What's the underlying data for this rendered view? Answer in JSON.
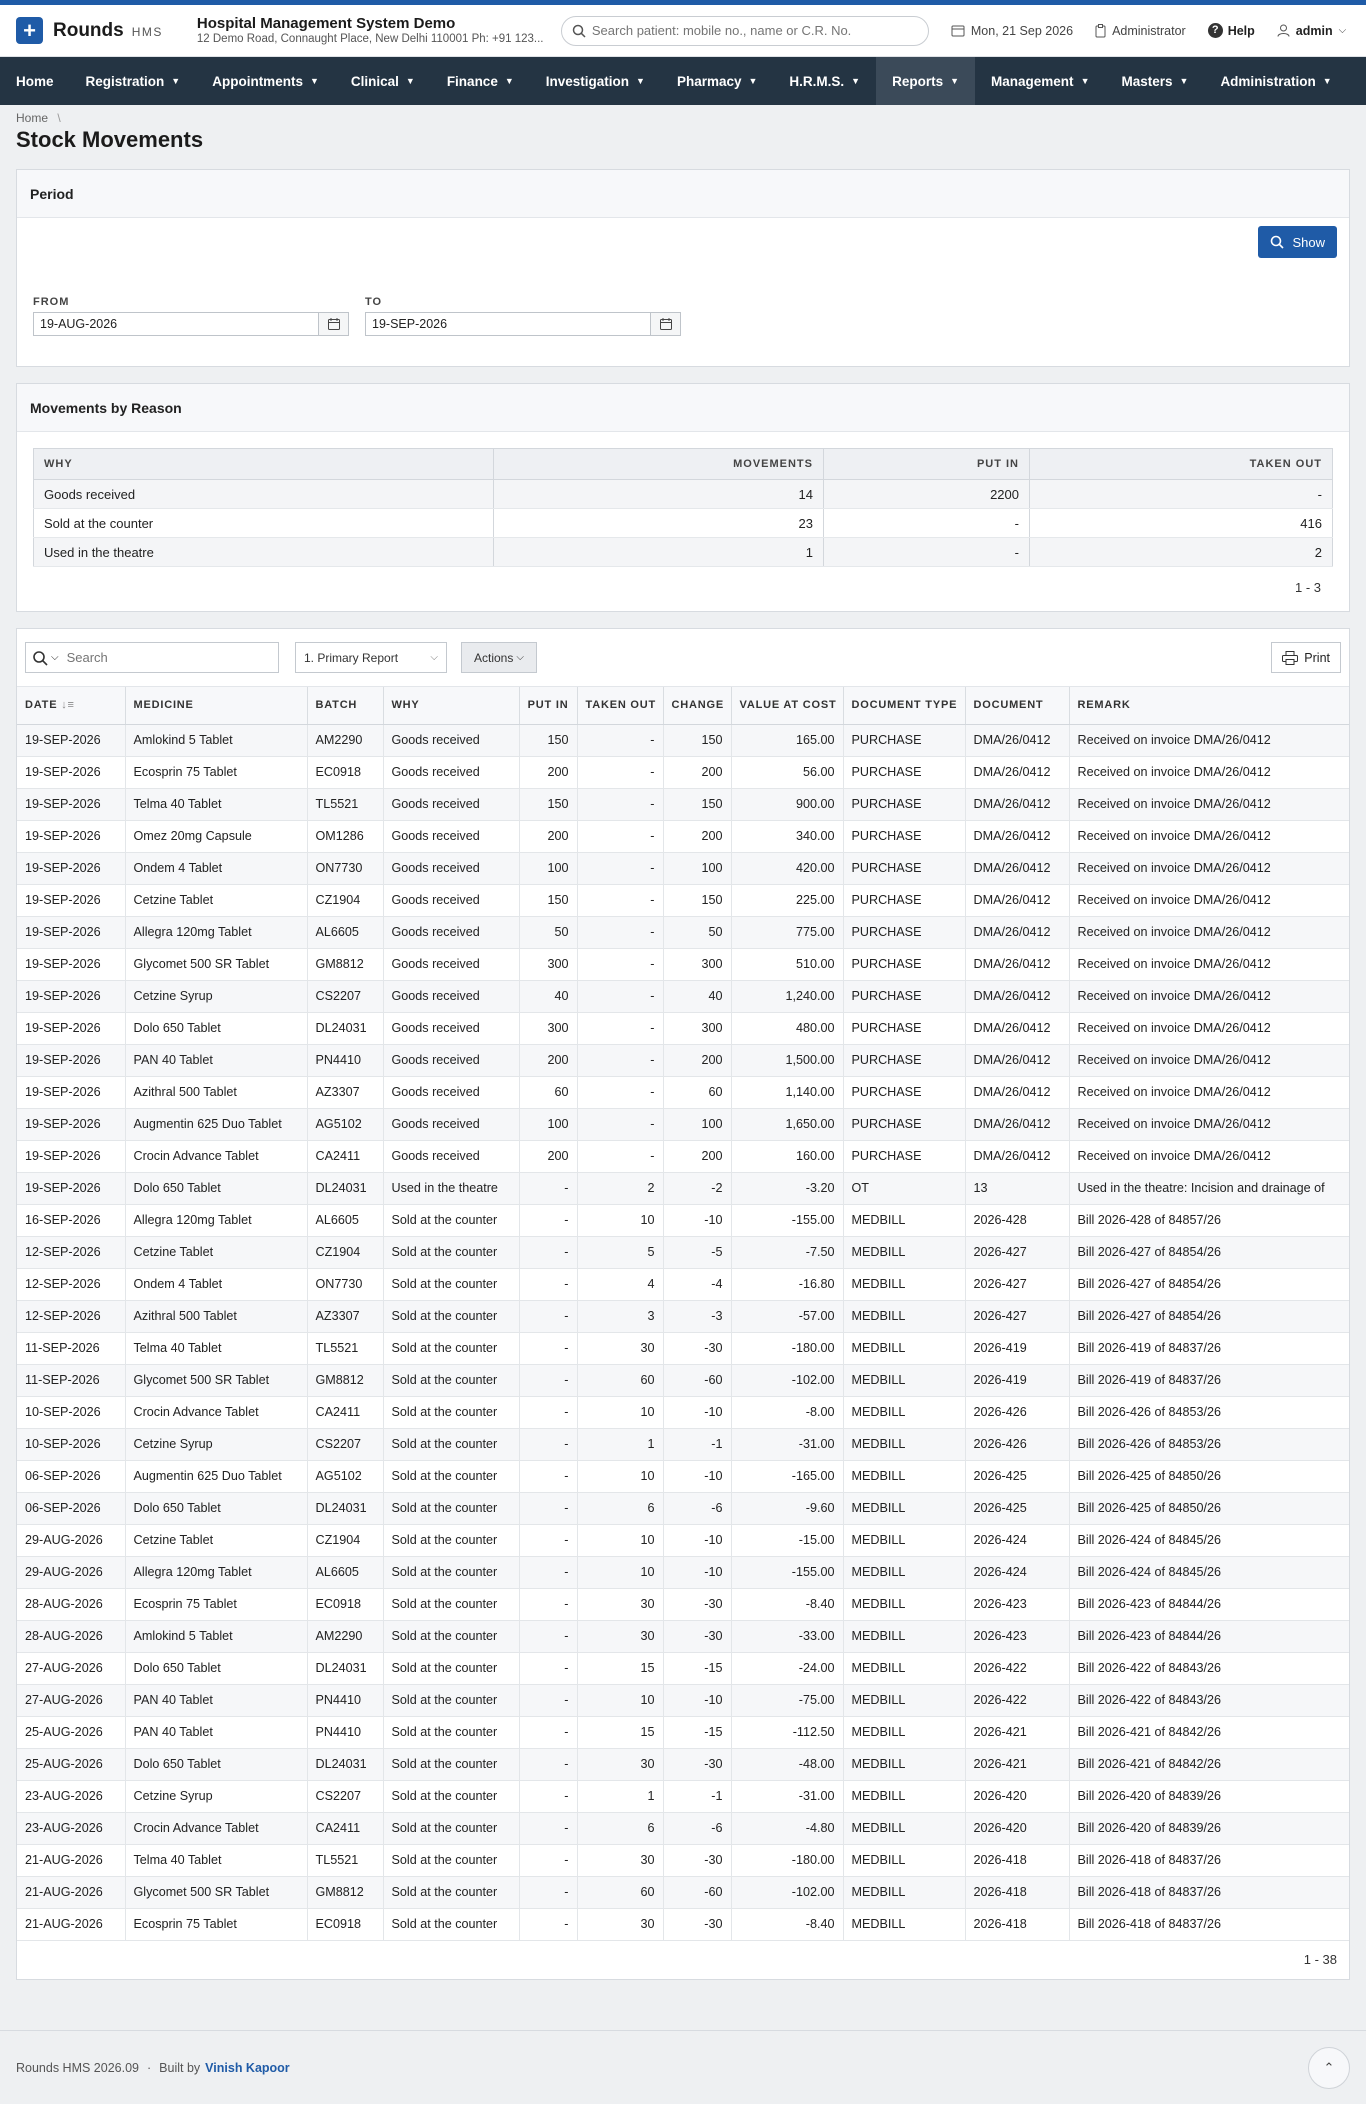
{
  "app": {
    "name": "Rounds",
    "sub": "HMS"
  },
  "org": {
    "name": "Hospital Management System Demo",
    "address": "12 Demo Road, Connaught Place, New Delhi 110001 Ph: +91 123..."
  },
  "search": {
    "placeholder": "Search patient: mobile no., name or C.R. No."
  },
  "header": {
    "date": "Mon, 21 Sep 2026",
    "role": "Administrator",
    "help": "Help",
    "user": "admin"
  },
  "nav": [
    "Home",
    "Registration",
    "Appointments",
    "Clinical",
    "Finance",
    "Investigation",
    "Pharmacy",
    "H.R.M.S.",
    "Reports",
    "Management",
    "Masters",
    "Administration"
  ],
  "breadcrumb": {
    "home": "Home",
    "sep": "\\"
  },
  "page": {
    "title": "Stock Movements"
  },
  "period": {
    "heading": "Period",
    "show": "Show",
    "from_label": "FROM",
    "from_value": "19-AUG-2026",
    "to_label": "TO",
    "to_value": "19-SEP-2026"
  },
  "reasons": {
    "heading": "Movements by Reason",
    "columns": [
      "WHY",
      "MOVEMENTS",
      "PUT IN",
      "TAKEN OUT"
    ],
    "rows": [
      [
        "Goods received",
        "14",
        "2200",
        "-"
      ],
      [
        "Sold at the counter",
        "23",
        "-",
        "416"
      ],
      [
        "Used in the theatre",
        "1",
        "-",
        "2"
      ]
    ],
    "pager": "1 - 3"
  },
  "toolbar": {
    "search_placeholder": "Search",
    "report": "1. Primary Report",
    "actions": "Actions",
    "print": "Print"
  },
  "movements": {
    "columns": [
      "DATE",
      "MEDICINE",
      "BATCH",
      "WHY",
      "PUT IN",
      "TAKEN OUT",
      "CHANGE",
      "VALUE AT COST",
      "DOCUMENT TYPE",
      "DOCUMENT",
      "REMARK"
    ],
    "rows": [
      [
        "19-SEP-2026",
        "Amlokind 5 Tablet",
        "AM2290",
        "Goods received",
        "150",
        "-",
        "150",
        "165.00",
        "PURCHASE",
        "DMA/26/0412",
        "Received on invoice DMA/26/0412"
      ],
      [
        "19-SEP-2026",
        "Ecosprin 75 Tablet",
        "EC0918",
        "Goods received",
        "200",
        "-",
        "200",
        "56.00",
        "PURCHASE",
        "DMA/26/0412",
        "Received on invoice DMA/26/0412"
      ],
      [
        "19-SEP-2026",
        "Telma 40 Tablet",
        "TL5521",
        "Goods received",
        "150",
        "-",
        "150",
        "900.00",
        "PURCHASE",
        "DMA/26/0412",
        "Received on invoice DMA/26/0412"
      ],
      [
        "19-SEP-2026",
        "Omez 20mg Capsule",
        "OM1286",
        "Goods received",
        "200",
        "-",
        "200",
        "340.00",
        "PURCHASE",
        "DMA/26/0412",
        "Received on invoice DMA/26/0412"
      ],
      [
        "19-SEP-2026",
        "Ondem 4 Tablet",
        "ON7730",
        "Goods received",
        "100",
        "-",
        "100",
        "420.00",
        "PURCHASE",
        "DMA/26/0412",
        "Received on invoice DMA/26/0412"
      ],
      [
        "19-SEP-2026",
        "Cetzine Tablet",
        "CZ1904",
        "Goods received",
        "150",
        "-",
        "150",
        "225.00",
        "PURCHASE",
        "DMA/26/0412",
        "Received on invoice DMA/26/0412"
      ],
      [
        "19-SEP-2026",
        "Allegra 120mg Tablet",
        "AL6605",
        "Goods received",
        "50",
        "-",
        "50",
        "775.00",
        "PURCHASE",
        "DMA/26/0412",
        "Received on invoice DMA/26/0412"
      ],
      [
        "19-SEP-2026",
        "Glycomet 500 SR Tablet",
        "GM8812",
        "Goods received",
        "300",
        "-",
        "300",
        "510.00",
        "PURCHASE",
        "DMA/26/0412",
        "Received on invoice DMA/26/0412"
      ],
      [
        "19-SEP-2026",
        "Cetzine Syrup",
        "CS2207",
        "Goods received",
        "40",
        "-",
        "40",
        "1,240.00",
        "PURCHASE",
        "DMA/26/0412",
        "Received on invoice DMA/26/0412"
      ],
      [
        "19-SEP-2026",
        "Dolo 650 Tablet",
        "DL24031",
        "Goods received",
        "300",
        "-",
        "300",
        "480.00",
        "PURCHASE",
        "DMA/26/0412",
        "Received on invoice DMA/26/0412"
      ],
      [
        "19-SEP-2026",
        "PAN 40 Tablet",
        "PN4410",
        "Goods received",
        "200",
        "-",
        "200",
        "1,500.00",
        "PURCHASE",
        "DMA/26/0412",
        "Received on invoice DMA/26/0412"
      ],
      [
        "19-SEP-2026",
        "Azithral 500 Tablet",
        "AZ3307",
        "Goods received",
        "60",
        "-",
        "60",
        "1,140.00",
        "PURCHASE",
        "DMA/26/0412",
        "Received on invoice DMA/26/0412"
      ],
      [
        "19-SEP-2026",
        "Augmentin 625 Duo Tablet",
        "AG5102",
        "Goods received",
        "100",
        "-",
        "100",
        "1,650.00",
        "PURCHASE",
        "DMA/26/0412",
        "Received on invoice DMA/26/0412"
      ],
      [
        "19-SEP-2026",
        "Crocin Advance Tablet",
        "CA2411",
        "Goods received",
        "200",
        "-",
        "200",
        "160.00",
        "PURCHASE",
        "DMA/26/0412",
        "Received on invoice DMA/26/0412"
      ],
      [
        "19-SEP-2026",
        "Dolo 650 Tablet",
        "DL24031",
        "Used in the theatre",
        "-",
        "2",
        "-2",
        "-3.20",
        "OT",
        "13",
        "Used in the theatre: Incision and drainage of"
      ],
      [
        "16-SEP-2026",
        "Allegra 120mg Tablet",
        "AL6605",
        "Sold at the counter",
        "-",
        "10",
        "-10",
        "-155.00",
        "MEDBILL",
        "2026-428",
        "Bill 2026-428 of 84857/26"
      ],
      [
        "12-SEP-2026",
        "Cetzine Tablet",
        "CZ1904",
        "Sold at the counter",
        "-",
        "5",
        "-5",
        "-7.50",
        "MEDBILL",
        "2026-427",
        "Bill 2026-427 of 84854/26"
      ],
      [
        "12-SEP-2026",
        "Ondem 4 Tablet",
        "ON7730",
        "Sold at the counter",
        "-",
        "4",
        "-4",
        "-16.80",
        "MEDBILL",
        "2026-427",
        "Bill 2026-427 of 84854/26"
      ],
      [
        "12-SEP-2026",
        "Azithral 500 Tablet",
        "AZ3307",
        "Sold at the counter",
        "-",
        "3",
        "-3",
        "-57.00",
        "MEDBILL",
        "2026-427",
        "Bill 2026-427 of 84854/26"
      ],
      [
        "11-SEP-2026",
        "Telma 40 Tablet",
        "TL5521",
        "Sold at the counter",
        "-",
        "30",
        "-30",
        "-180.00",
        "MEDBILL",
        "2026-419",
        "Bill 2026-419 of 84837/26"
      ],
      [
        "11-SEP-2026",
        "Glycomet 500 SR Tablet",
        "GM8812",
        "Sold at the counter",
        "-",
        "60",
        "-60",
        "-102.00",
        "MEDBILL",
        "2026-419",
        "Bill 2026-419 of 84837/26"
      ],
      [
        "10-SEP-2026",
        "Crocin Advance Tablet",
        "CA2411",
        "Sold at the counter",
        "-",
        "10",
        "-10",
        "-8.00",
        "MEDBILL",
        "2026-426",
        "Bill 2026-426 of 84853/26"
      ],
      [
        "10-SEP-2026",
        "Cetzine Syrup",
        "CS2207",
        "Sold at the counter",
        "-",
        "1",
        "-1",
        "-31.00",
        "MEDBILL",
        "2026-426",
        "Bill 2026-426 of 84853/26"
      ],
      [
        "06-SEP-2026",
        "Augmentin 625 Duo Tablet",
        "AG5102",
        "Sold at the counter",
        "-",
        "10",
        "-10",
        "-165.00",
        "MEDBILL",
        "2026-425",
        "Bill 2026-425 of 84850/26"
      ],
      [
        "06-SEP-2026",
        "Dolo 650 Tablet",
        "DL24031",
        "Sold at the counter",
        "-",
        "6",
        "-6",
        "-9.60",
        "MEDBILL",
        "2026-425",
        "Bill 2026-425 of 84850/26"
      ],
      [
        "29-AUG-2026",
        "Cetzine Tablet",
        "CZ1904",
        "Sold at the counter",
        "-",
        "10",
        "-10",
        "-15.00",
        "MEDBILL",
        "2026-424",
        "Bill 2026-424 of 84845/26"
      ],
      [
        "29-AUG-2026",
        "Allegra 120mg Tablet",
        "AL6605",
        "Sold at the counter",
        "-",
        "10",
        "-10",
        "-155.00",
        "MEDBILL",
        "2026-424",
        "Bill 2026-424 of 84845/26"
      ],
      [
        "28-AUG-2026",
        "Ecosprin 75 Tablet",
        "EC0918",
        "Sold at the counter",
        "-",
        "30",
        "-30",
        "-8.40",
        "MEDBILL",
        "2026-423",
        "Bill 2026-423 of 84844/26"
      ],
      [
        "28-AUG-2026",
        "Amlokind 5 Tablet",
        "AM2290",
        "Sold at the counter",
        "-",
        "30",
        "-30",
        "-33.00",
        "MEDBILL",
        "2026-423",
        "Bill 2026-423 of 84844/26"
      ],
      [
        "27-AUG-2026",
        "Dolo 650 Tablet",
        "DL24031",
        "Sold at the counter",
        "-",
        "15",
        "-15",
        "-24.00",
        "MEDBILL",
        "2026-422",
        "Bill 2026-422 of 84843/26"
      ],
      [
        "27-AUG-2026",
        "PAN 40 Tablet",
        "PN4410",
        "Sold at the counter",
        "-",
        "10",
        "-10",
        "-75.00",
        "MEDBILL",
        "2026-422",
        "Bill 2026-422 of 84843/26"
      ],
      [
        "25-AUG-2026",
        "PAN 40 Tablet",
        "PN4410",
        "Sold at the counter",
        "-",
        "15",
        "-15",
        "-112.50",
        "MEDBILL",
        "2026-421",
        "Bill 2026-421 of 84842/26"
      ],
      [
        "25-AUG-2026",
        "Dolo 650 Tablet",
        "DL24031",
        "Sold at the counter",
        "-",
        "30",
        "-30",
        "-48.00",
        "MEDBILL",
        "2026-421",
        "Bill 2026-421 of 84842/26"
      ],
      [
        "23-AUG-2026",
        "Cetzine Syrup",
        "CS2207",
        "Sold at the counter",
        "-",
        "1",
        "-1",
        "-31.00",
        "MEDBILL",
        "2026-420",
        "Bill 2026-420 of 84839/26"
      ],
      [
        "23-AUG-2026",
        "Crocin Advance Tablet",
        "CA2411",
        "Sold at the counter",
        "-",
        "6",
        "-6",
        "-4.80",
        "MEDBILL",
        "2026-420",
        "Bill 2026-420 of 84839/26"
      ],
      [
        "21-AUG-2026",
        "Telma 40 Tablet",
        "TL5521",
        "Sold at the counter",
        "-",
        "30",
        "-30",
        "-180.00",
        "MEDBILL",
        "2026-418",
        "Bill 2026-418 of 84837/26"
      ],
      [
        "21-AUG-2026",
        "Glycomet 500 SR Tablet",
        "GM8812",
        "Sold at the counter",
        "-",
        "60",
        "-60",
        "-102.00",
        "MEDBILL",
        "2026-418",
        "Bill 2026-418 of 84837/26"
      ],
      [
        "21-AUG-2026",
        "Ecosprin 75 Tablet",
        "EC0918",
        "Sold at the counter",
        "-",
        "30",
        "-30",
        "-8.40",
        "MEDBILL",
        "2026-418",
        "Bill 2026-418 of 84837/26"
      ]
    ],
    "pager": "1 - 38"
  },
  "footer": {
    "version": "Rounds HMS 2026.09",
    "dot": "·",
    "built_by": "Built by",
    "author": "Vinish Kapoor"
  },
  "colors": {
    "brand": "#1f5ba7",
    "navbar": "#243443"
  },
  "icons": {
    "logo": "plus-icon",
    "search": "search-icon",
    "calendar": "calendar-icon",
    "print": "printer-icon",
    "up": "chevron-up-icon"
  }
}
